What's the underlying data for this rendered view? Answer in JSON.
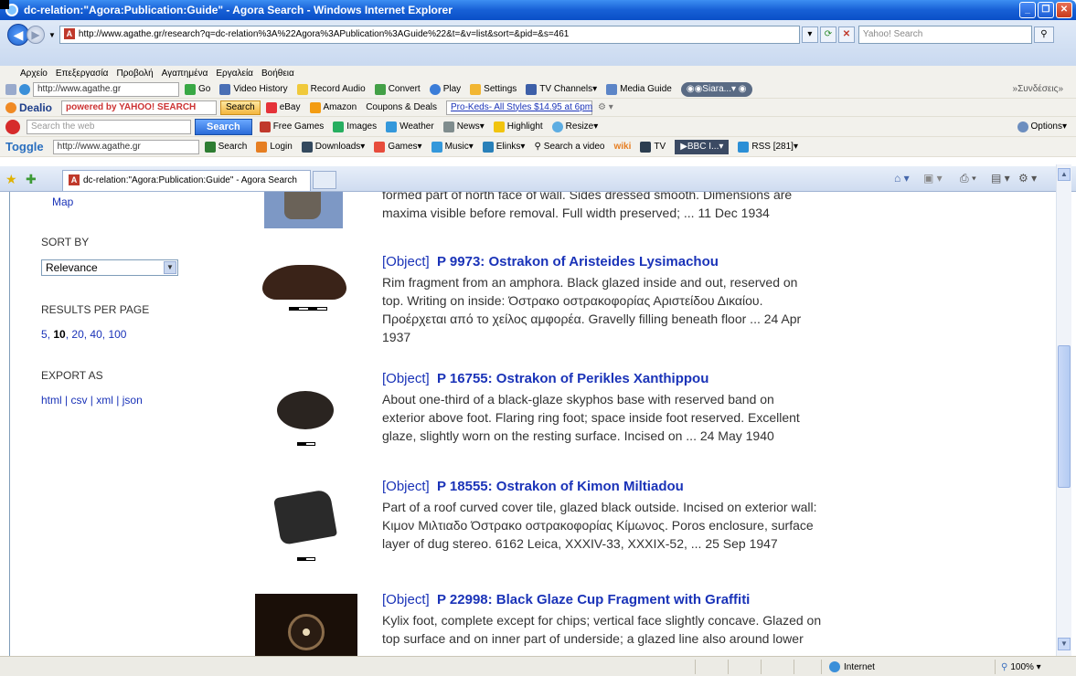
{
  "window": {
    "title": "dc-relation:\"Agora:Publication:Guide\" - Agora Search - Windows Internet Explorer"
  },
  "address": {
    "url": "http://www.agathe.gr/research?q=dc-relation%3A%22Agora%3APublication%3AGuide%22&t=&v=list&sort=&pid=&s=461",
    "search_placeholder": "Yahoo! Search"
  },
  "menu": [
    "Αρχείο",
    "Επεξεργασία",
    "Προβολή",
    "Αγαπημένα",
    "Εργαλεία",
    "Βοήθεια"
  ],
  "toolbar1": {
    "url": "http://www.agathe.gr",
    "go": "Go",
    "items": [
      "Video History",
      "Record Audio",
      "Convert",
      "Play",
      "Settings",
      "TV Channels",
      "Media Guide"
    ],
    "player": "Siara...",
    "links": "Συνδέσεις"
  },
  "toolbar2": {
    "dealio": "Dealio",
    "powered": "powered by YAHOO! SEARCH",
    "search": "Search",
    "ebay": "eBay",
    "amazon": "Amazon",
    "coupons": "Coupons & Deals",
    "promo": "Pro-Keds- All Styles $14.95 at 6pm"
  },
  "toolbar3": {
    "placeholder": "Search the web",
    "search": "Search",
    "items": [
      "Free Games",
      "Images",
      "Weather",
      "News",
      "Highlight",
      "Resize"
    ],
    "options": "Options"
  },
  "toolbar4": {
    "toggle": "Toggle",
    "url": "http://www.agathe.gr",
    "search": "Search",
    "items": [
      "Login",
      "Downloads",
      "Games",
      "Music",
      "Elinks",
      "Search a video",
      "wiki",
      "TV"
    ],
    "player": "BBC I...",
    "rss": "RSS [281]"
  },
  "tab": {
    "title": "dc-relation:\"Agora:Publication:Guide\" - Agora Search"
  },
  "sidebar": {
    "map": "Map",
    "sort_label": "SORT BY",
    "sort_value": "Relevance",
    "rpp_label": "RESULTS PER PAGE",
    "rpp": [
      "5",
      "10",
      "20",
      "40",
      "100"
    ],
    "rpp_selected": "10",
    "export_label": "EXPORT AS",
    "export": [
      "html",
      "csv",
      "xml",
      "json"
    ]
  },
  "partial": {
    "line1": "formed part of north face of wall. Sides dressed smooth. Dimensions are",
    "line2": "maxima visible before removal. Full width preserved; ... 11 Dec 1934"
  },
  "results": [
    {
      "type": "[Object]",
      "id": "P 9973: Ostrakon of Aristeides Lysimachou",
      "lines": [
        "Rim fragment from an amphora. Black glazed inside and out, reserved on",
        "top. Writing on inside: Όστρακο οστρακοφορίας Αριστείδου Δικαίου.",
        "Προέρχεται από το χείλος αμφορέα. Gravelly filling beneath floor ... 24 Apr",
        "1937"
      ]
    },
    {
      "type": "[Object]",
      "id": "P 16755: Ostrakon of Perikles Xanthippou",
      "lines": [
        "About one-third of a black-glaze skyphos base with reserved band on",
        "exterior above foot. Flaring ring foot; space inside foot reserved. Excellent",
        "glaze, slightly worn on the resting surface. Incised on ... 24 May 1940"
      ]
    },
    {
      "type": "[Object]",
      "id": "P 18555: Ostrakon of Kimon Miltiadou",
      "lines": [
        "Part of a roof curved cover tile, glazed black outside. Incised on exterior wall:",
        "Κιμον Μιλτιαδο Όστρακο οστρακοφορίας Κίμωνος. Poros enclosure, surface",
        "layer of dug stereo. 6162 Leica, XXXIV-33, XXXIX-52, ... 25 Sep 1947"
      ]
    },
    {
      "type": "[Object]",
      "id": "P 22998: Black Glaze Cup Fragment with Graffiti",
      "lines": [
        "Kylix foot, complete except for chips; vertical face slightly concave. Glazed on",
        "top surface and on inner part of underside; a glazed line also around lower"
      ]
    }
  ],
  "status": {
    "zone": "Internet",
    "zoom": "100%"
  }
}
